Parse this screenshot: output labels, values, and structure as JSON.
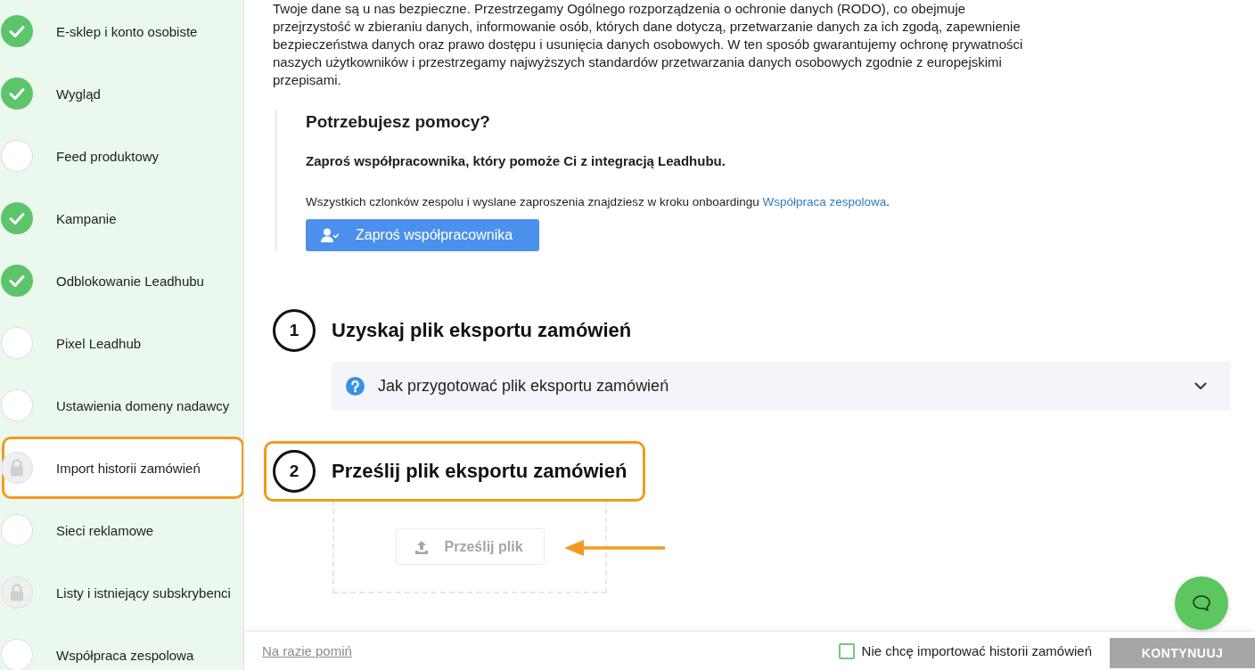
{
  "sidebar": {
    "items": [
      {
        "label": "E-sklep i konto osobiste",
        "kind": "done",
        "selected": false
      },
      {
        "label": "Wygląd",
        "kind": "done",
        "selected": false
      },
      {
        "label": "Feed produktowy",
        "kind": "todo",
        "selected": false
      },
      {
        "label": "Kampanie",
        "kind": "done",
        "selected": false
      },
      {
        "label": "Odblokowanie Leadhubu",
        "kind": "done",
        "selected": false
      },
      {
        "label": "Pixel Leadhub",
        "kind": "todo",
        "selected": false
      },
      {
        "label": "Ustawienia domeny nadawcy",
        "kind": "todo",
        "selected": false
      },
      {
        "label": "Import historii zamówień",
        "kind": "locked",
        "selected": true
      },
      {
        "label": "Sieci reklamowe",
        "kind": "todo",
        "selected": false
      },
      {
        "label": "Listy i istniejący subskrybenci",
        "kind": "locked",
        "selected": false
      },
      {
        "label": "Współpraca zespolowa",
        "kind": "todo",
        "selected": false
      }
    ]
  },
  "intro": {
    "text": "Twoje dane są u nas bezpieczne. Przestrzegamy Ogólnego rozporządzenia o ochronie danych (RODO), co obejmuje przejrzystość w zbieraniu danych, informowanie osób, których dane dotyczą, przetwarzanie danych za ich zgodą, zapewnienie bezpieczeństwa danych oraz prawo dostępu i usunięcia danych osobowych. W ten sposób gwarantujemy ochronę prywatności naszych użytkowników i przestrzegamy najwyższych standardów przetwarzania danych osobowych zgodnie z europejskimi przepisami."
  },
  "help": {
    "title": "Potrzebujesz pomocy?",
    "subtitle": "Zaproś współpracownika, który pomoże Ci z integracją Leadhubu.",
    "note": {
      "text": "Wszystkich czlonków zespolu i wyslane zaproszenia znajdziesz w kroku onboardingu",
      "link": "Współpraca zespolowa",
      "text_after": "."
    },
    "button": {
      "label": "Zaproś współpracownika"
    }
  },
  "steps": [
    {
      "number": "1",
      "title": "Uzyskaj plik eksportu zamówień",
      "highlighted": false,
      "kind": "guide",
      "accordion": {
        "label": "Jak przygotować plik eksportu zamówień",
        "expanded": false
      }
    },
    {
      "number": "2",
      "title": "Prześlij plik eksportu zamówień",
      "highlighted": true,
      "kind": "upload",
      "upload": {
        "label": "Prześlij plik",
        "disabled": true
      }
    }
  ],
  "footer": {
    "skip_link": "Na razie pomiń",
    "opt_out": {
      "label": "Nie chcę importować historii zamówień",
      "checked": false
    },
    "continue_button": {
      "label": "KONTYNUUJ",
      "disabled": true
    }
  }
}
